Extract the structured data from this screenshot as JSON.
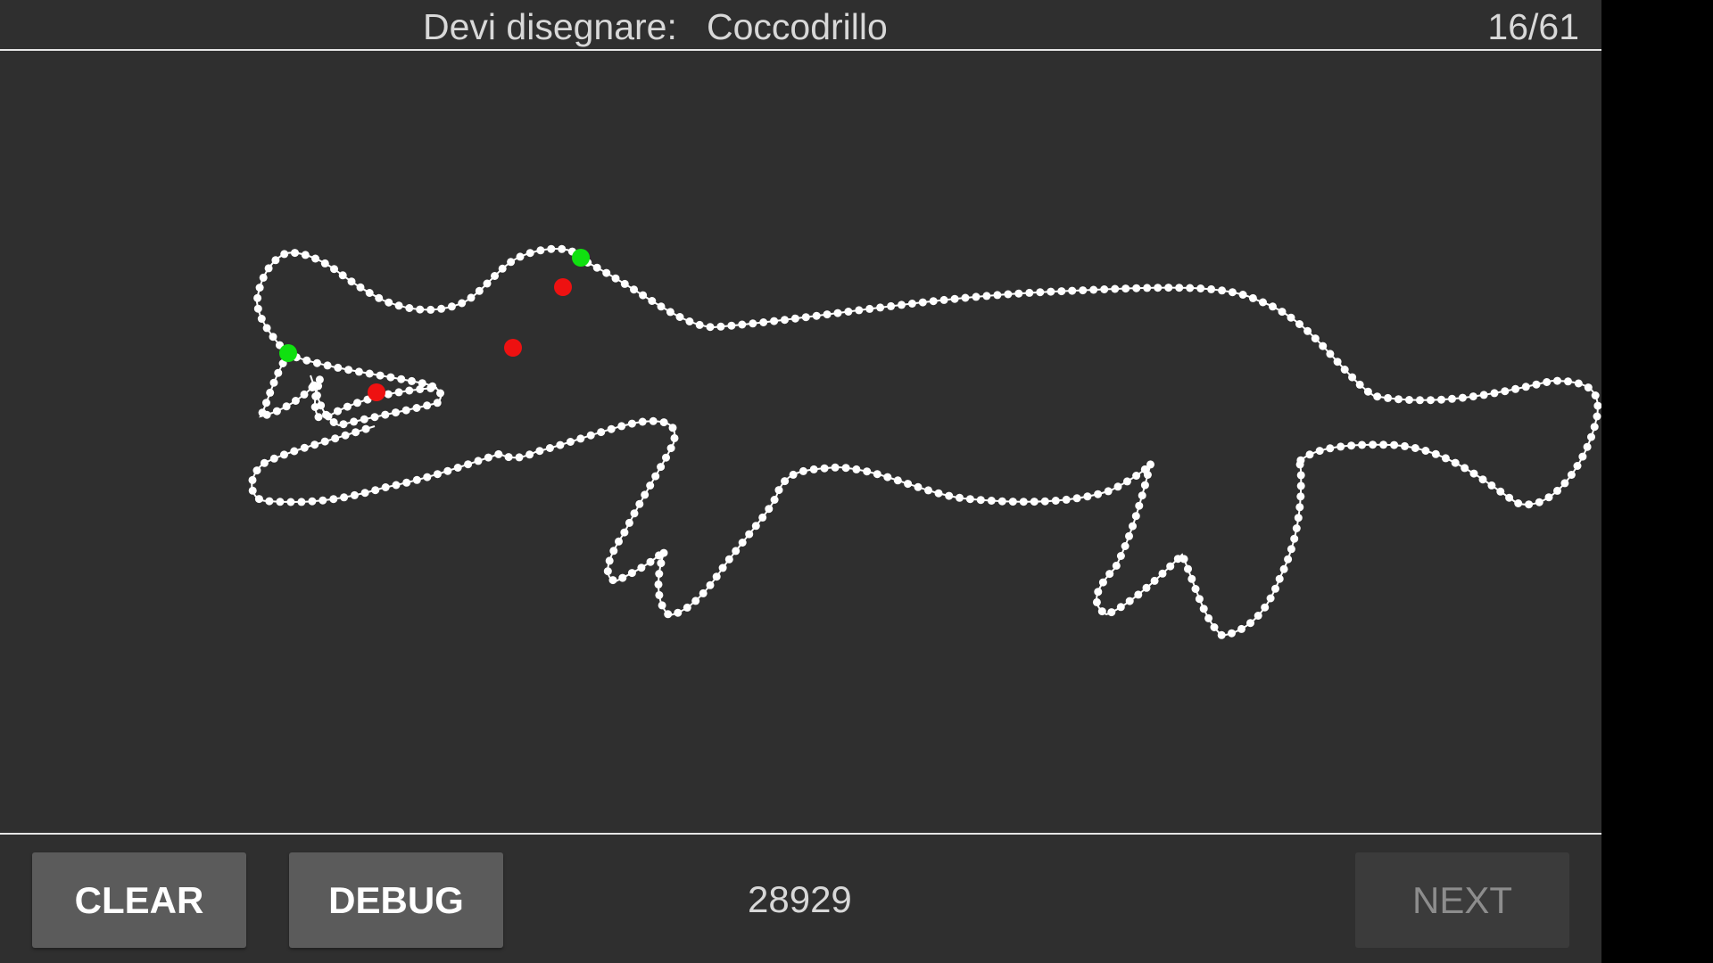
{
  "header": {
    "prompt_label": "Devi disegnare:",
    "prompt_word": "Coccodrillo",
    "progress": "16/61"
  },
  "footer": {
    "clear_label": "CLEAR",
    "debug_label": "DEBUG",
    "score": "28929",
    "next_label": "NEXT",
    "next_enabled": false
  },
  "drawing": {
    "stroke_color": "#ffffff",
    "start_marker_color": "#10e010",
    "end_marker_color": "#ee1111"
  }
}
